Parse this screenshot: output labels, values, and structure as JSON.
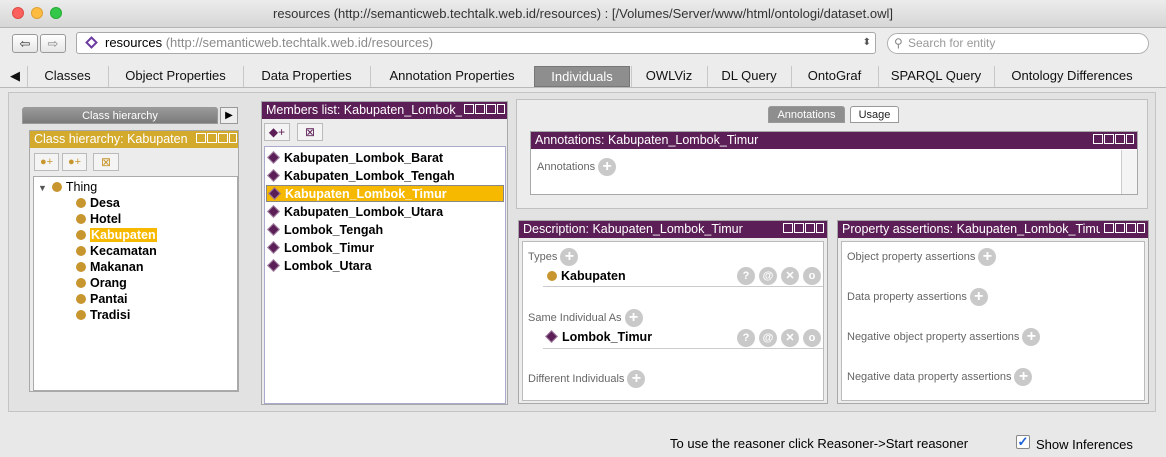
{
  "window": {
    "title": "resources (http://semanticweb.techtalk.web.id/resources)  : [/Volumes/Server/www/html/ontologi/dataset.owl]"
  },
  "toolbar": {
    "back": "⇦",
    "forward": "⇨",
    "address_name": "resources",
    "address_url": "(http://semanticweb.techtalk.web.id/resources)",
    "search_placeholder": "Search for entity"
  },
  "tabs": [
    {
      "label": "Classes"
    },
    {
      "label": "Object Properties"
    },
    {
      "label": "Data Properties"
    },
    {
      "label": "Annotation Properties"
    },
    {
      "label": "Individuals"
    },
    {
      "label": "OWLViz"
    },
    {
      "label": "DL Query"
    },
    {
      "label": "OntoGraf"
    },
    {
      "label": "SPARQL Query"
    },
    {
      "label": "Ontology Differences"
    }
  ],
  "class_panel": {
    "tab_label": "Class hierarchy",
    "header": "Class hierarchy: Kabupaten",
    "root": "Thing",
    "items": [
      "Desa",
      "Hotel",
      "Kabupaten",
      "Kecamatan",
      "Makanan",
      "Orang",
      "Pantai",
      "Tradisi"
    ]
  },
  "members": {
    "header": "Members list: Kabupaten_Lombok_Timur",
    "items": [
      "Kabupaten_Lombok_Barat",
      "Kabupaten_Lombok_Tengah",
      "Kabupaten_Lombok_Timur",
      "Kabupaten_Lombok_Utara",
      "Lombok_Tengah",
      "Lombok_Timur",
      "Lombok_Utara"
    ]
  },
  "annotations": {
    "tab_annotations": "Annotations",
    "tab_usage": "Usage",
    "header": "Annotations: Kabupaten_Lombok_Timur",
    "label": "Annotations"
  },
  "description": {
    "header": "Description: Kabupaten_Lombok_Timur",
    "types_label": "Types",
    "type_value": "Kabupaten",
    "same_label": "Same Individual As",
    "same_value": "Lombok_Timur",
    "different_label": "Different Individuals"
  },
  "property": {
    "header": "Property assertions: Kabupaten_Lombok_Timur",
    "object": "Object property assertions",
    "data": "Data property assertions",
    "neg_object": "Negative object property assertions",
    "neg_data": "Negative data property assertions"
  },
  "status": {
    "reasoner_msg": "To use the reasoner click Reasoner->Start reasoner",
    "show_inferences": "Show Inferences"
  }
}
